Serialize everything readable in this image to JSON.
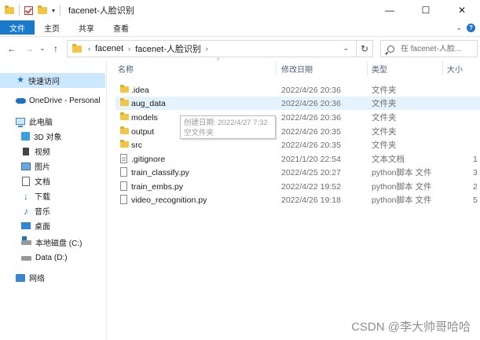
{
  "window": {
    "title": "facenet-人脸识别",
    "controls": {
      "minimize": "—",
      "maximize": "☐",
      "close": "✕"
    }
  },
  "ribbon": {
    "tabs": [
      {
        "label": "文件",
        "active": true
      },
      {
        "label": "主页"
      },
      {
        "label": "共享"
      },
      {
        "label": "查看"
      }
    ],
    "accent": "#1979ca"
  },
  "address": {
    "crumbs": [
      "facenet",
      "facenet-人脸识别"
    ],
    "search_placeholder": "在 facenet-人脸..."
  },
  "sidebar": {
    "items": [
      {
        "label": "快速访问",
        "icon": "star-icon",
        "selected": true
      },
      {
        "label": "OneDrive - Personal",
        "icon": "cloud-icon"
      },
      {
        "label": "此电脑",
        "icon": "computer-icon"
      },
      {
        "label": "3D 对象",
        "icon": "cube-icon"
      },
      {
        "label": "视频",
        "icon": "video-icon"
      },
      {
        "label": "图片",
        "icon": "picture-icon"
      },
      {
        "label": "文档",
        "icon": "document-icon"
      },
      {
        "label": "下载",
        "icon": "download-icon"
      },
      {
        "label": "音乐",
        "icon": "music-icon"
      },
      {
        "label": "桌面",
        "icon": "desktop-icon"
      },
      {
        "label": "本地磁盘 (C:)",
        "icon": "drive-c-icon"
      },
      {
        "label": "Data (D:)",
        "icon": "drive-d-icon"
      },
      {
        "label": "网络",
        "icon": "network-icon"
      }
    ]
  },
  "columns": {
    "name": "名称",
    "date": "修改日期",
    "type": "类型",
    "size": "大小"
  },
  "files": [
    {
      "name": ".idea",
      "date": "2022/4/26 20:36",
      "type": "文件夹",
      "size": "",
      "kind": "folder"
    },
    {
      "name": "aug_data",
      "date": "2022/4/26 20:36",
      "type": "文件夹",
      "size": "",
      "kind": "folder"
    },
    {
      "name": "models",
      "date": "2022/4/26 20:36",
      "type": "文件夹",
      "size": "",
      "kind": "folder"
    },
    {
      "name": "output",
      "date": "2022/4/26 20:35",
      "type": "文件夹",
      "size": "",
      "kind": "folder"
    },
    {
      "name": "src",
      "date": "2022/4/26 20:35",
      "type": "文件夹",
      "size": "",
      "kind": "folder"
    },
    {
      "name": ".gitignore",
      "date": "2021/1/20 22:54",
      "type": "文本文档",
      "size": "1",
      "kind": "text"
    },
    {
      "name": "train_classify.py",
      "date": "2022/4/25 20:27",
      "type": "python脚本 文件",
      "size": "3",
      "kind": "py"
    },
    {
      "name": "train_embs.py",
      "date": "2022/4/22 19:52",
      "type": "python脚本 文件",
      "size": "2",
      "kind": "py"
    },
    {
      "name": "video_recognition.py",
      "date": "2022/4/26 19:18",
      "type": "python脚本 文件",
      "size": "5",
      "kind": "py"
    }
  ],
  "tooltip": {
    "line1": "创建日期: 2022/4/27 7:32",
    "line2": "空文件夹"
  },
  "watermark": "CSDN @李大帅哥哈哈"
}
